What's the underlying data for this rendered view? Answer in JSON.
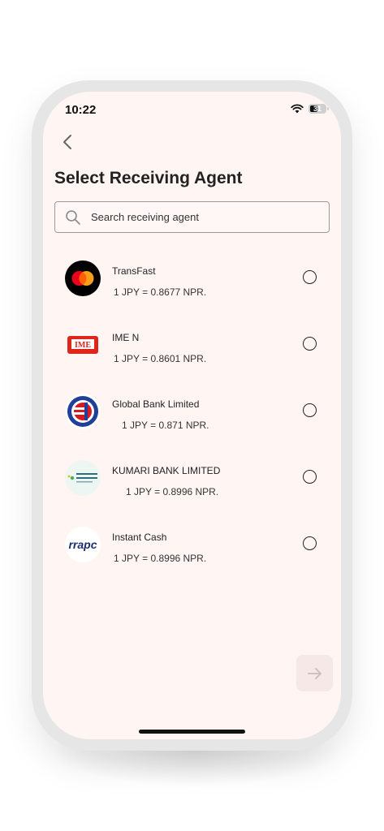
{
  "status_bar": {
    "time": "10:22",
    "battery": "31"
  },
  "header": {
    "title": "Select Receiving Agent"
  },
  "search": {
    "placeholder": "Search receiving agent"
  },
  "agents": [
    {
      "name": "TransFast",
      "rate": "1 JPY = 0.8677 NPR."
    },
    {
      "name": "IME N",
      "rate": "1 JPY = 0.8601 NPR."
    },
    {
      "name": "Global Bank Limited",
      "rate": "1 JPY = 0.871 NPR."
    },
    {
      "name": "KUMARI BANK LIMITED",
      "rate": "1 JPY = 0.8996 NPR."
    },
    {
      "name": "Instant Cash",
      "rate": "1 JPY = 0.8996 NPR."
    }
  ],
  "logos": {
    "ime": "IME",
    "instant_cash": "rrapc"
  },
  "colors": {
    "screen_bg": "#fff6f4",
    "mastercard_red": "#eb001b",
    "mastercard_yellow": "#f79e1b",
    "ime_red": "#e0261b",
    "global_blue": "#1f3f9a",
    "global_red": "#d71920",
    "instant_cash_blue": "#1c2f6e"
  }
}
